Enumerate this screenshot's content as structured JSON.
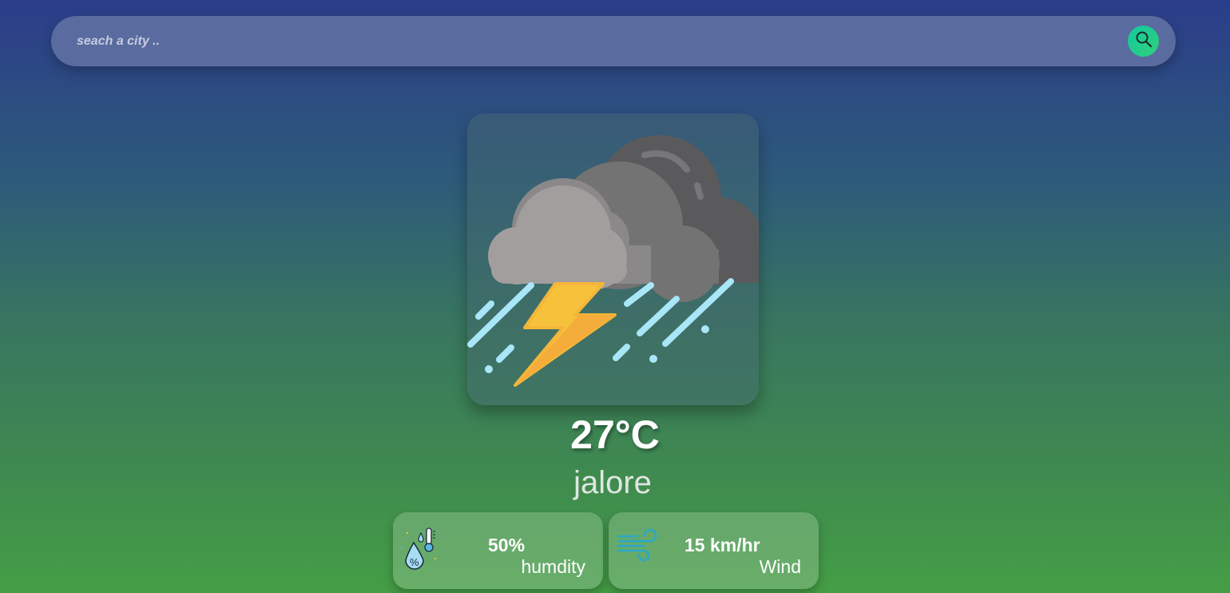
{
  "search": {
    "placeholder": "seach a city ..",
    "button_icon": "search-icon"
  },
  "weather": {
    "condition_icon": "thunderstorm-icon",
    "temperature": "27°C",
    "city": "jalore"
  },
  "stats": {
    "humidity": {
      "value": "50%",
      "label": "humdity",
      "icon": "humidity-icon"
    },
    "wind": {
      "value": "15 km/hr",
      "label": "Wind",
      "icon": "wind-icon"
    }
  },
  "colors": {
    "background_top": "#2b3d8a",
    "background_bottom": "#449e45",
    "search_bar": "#5a6b9f",
    "search_button": "#1fc98f"
  }
}
